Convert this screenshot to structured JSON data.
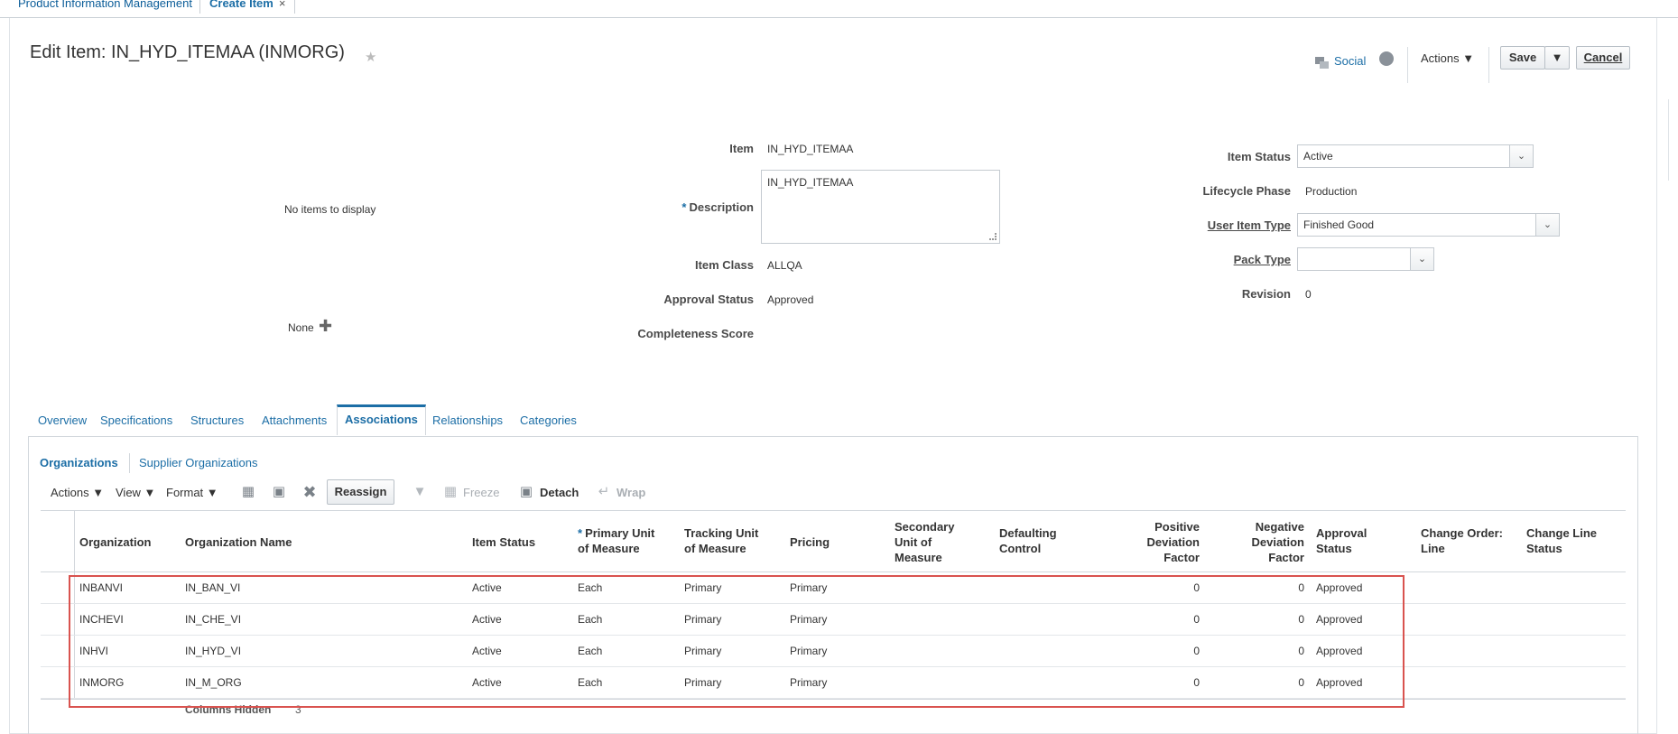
{
  "top_tabs": [
    {
      "label": "Product Information Management"
    },
    {
      "label": "Create Item",
      "close": "×"
    }
  ],
  "header": {
    "title": "Edit Item: IN_HYD_ITEMAA (INMORG)",
    "star": "★",
    "social_label": "Social",
    "actions_label": "Actions ▼",
    "save_label": "Save",
    "save_dropdown": "▼",
    "cancel_label": "Cancel"
  },
  "left_panel": {
    "no_items": "No items to display",
    "none_label": "None",
    "plus": "✚"
  },
  "form": {
    "item_label": "Item",
    "item_value": "IN_HYD_ITEMAA",
    "description_required": "*",
    "description_label": "Description",
    "description_value": "IN_HYD_ITEMAA",
    "item_class_label": "Item Class",
    "item_class_value": "ALLQA",
    "approval_status_label": "Approval Status",
    "approval_status_value": "Approved",
    "completeness_label": "Completeness Score",
    "item_status_label": "Item Status",
    "item_status_value": "Active",
    "lifecycle_label": "Lifecycle Phase",
    "lifecycle_value": "Production",
    "user_item_type_label": "User Item Type",
    "user_item_type_value": "Finished Good",
    "pack_type_label": "Pack Type",
    "pack_type_value": "",
    "revision_label": "Revision",
    "revision_value": "0"
  },
  "detail_tabs": [
    "Overview",
    "Specifications",
    "Structures",
    "Attachments",
    "Associations",
    "Relationships",
    "Categories"
  ],
  "sub_tabs": [
    "Organizations",
    "Supplier Organizations"
  ],
  "toolbar": {
    "actions": "Actions ▼",
    "view": "View ▼",
    "format": "Format ▼",
    "reassign": "Reassign",
    "freeze": "Freeze",
    "detach": "Detach",
    "wrap": "Wrap"
  },
  "table": {
    "headers": {
      "organization": "Organization",
      "organization_name": "Organization Name",
      "item_status": "Item Status",
      "primary_uom_req": "*",
      "primary_uom_1": "Primary Unit",
      "primary_uom_2": "of Measure",
      "tracking_uom_1": "Tracking Unit",
      "tracking_uom_2": "of Measure",
      "pricing": "Pricing",
      "secondary_uom_1": "Secondary",
      "secondary_uom_2": "Unit of",
      "secondary_uom_3": "Measure",
      "defaulting_1": "Defaulting",
      "defaulting_2": "Control",
      "positive_1": "Positive",
      "positive_2": "Deviation",
      "positive_3": "Factor",
      "negative_1": "Negative",
      "negative_2": "Deviation",
      "negative_3": "Factor",
      "approval_1": "Approval",
      "approval_2": "Status",
      "change_order_1": "Change Order:",
      "change_order_2": "Line",
      "change_line_1": "Change Line",
      "change_line_2": "Status"
    },
    "rows": [
      {
        "org": "INBANVI",
        "name": "IN_BAN_VI",
        "status": "Active",
        "primary": "Each",
        "tracking": "Primary",
        "pricing": "Primary",
        "pos": "0",
        "neg": "0",
        "approval": "Approved"
      },
      {
        "org": "INCHEVI",
        "name": "IN_CHE_VI",
        "status": "Active",
        "primary": "Each",
        "tracking": "Primary",
        "pricing": "Primary",
        "pos": "0",
        "neg": "0",
        "approval": "Approved"
      },
      {
        "org": "INHVI",
        "name": "IN_HYD_VI",
        "status": "Active",
        "primary": "Each",
        "tracking": "Primary",
        "pricing": "Primary",
        "pos": "0",
        "neg": "0",
        "approval": "Approved"
      },
      {
        "org": "INMORG",
        "name": "IN_M_ORG",
        "status": "Active",
        "primary": "Each",
        "tracking": "Primary",
        "pricing": "Primary",
        "pos": "0",
        "neg": "0",
        "approval": "Approved"
      }
    ],
    "columns_hidden_label": "Columns Hidden",
    "columns_hidden_value": "3"
  },
  "colors": {
    "link": "#1c6ea6",
    "highlight": "#d9534f"
  }
}
